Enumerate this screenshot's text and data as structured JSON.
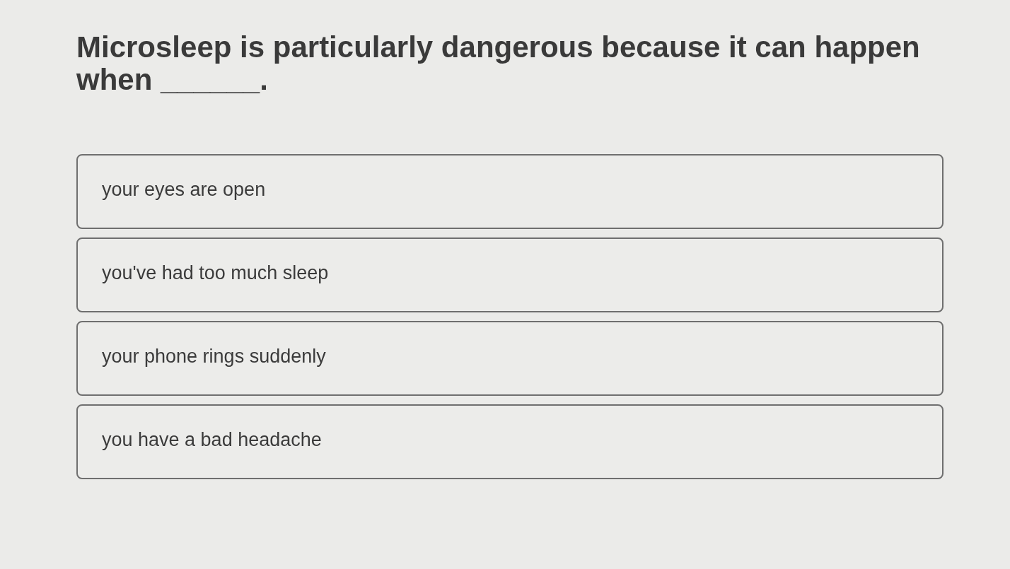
{
  "question": {
    "text": "Microsleep is particularly dangerous because it can happen when ______."
  },
  "options": [
    {
      "label": "your eyes are open",
      "selected": false
    },
    {
      "label": "you've had too much sleep",
      "selected": false
    },
    {
      "label": "your phone rings suddenly",
      "selected": false
    },
    {
      "label": "you have a bad headache",
      "selected": false
    }
  ]
}
